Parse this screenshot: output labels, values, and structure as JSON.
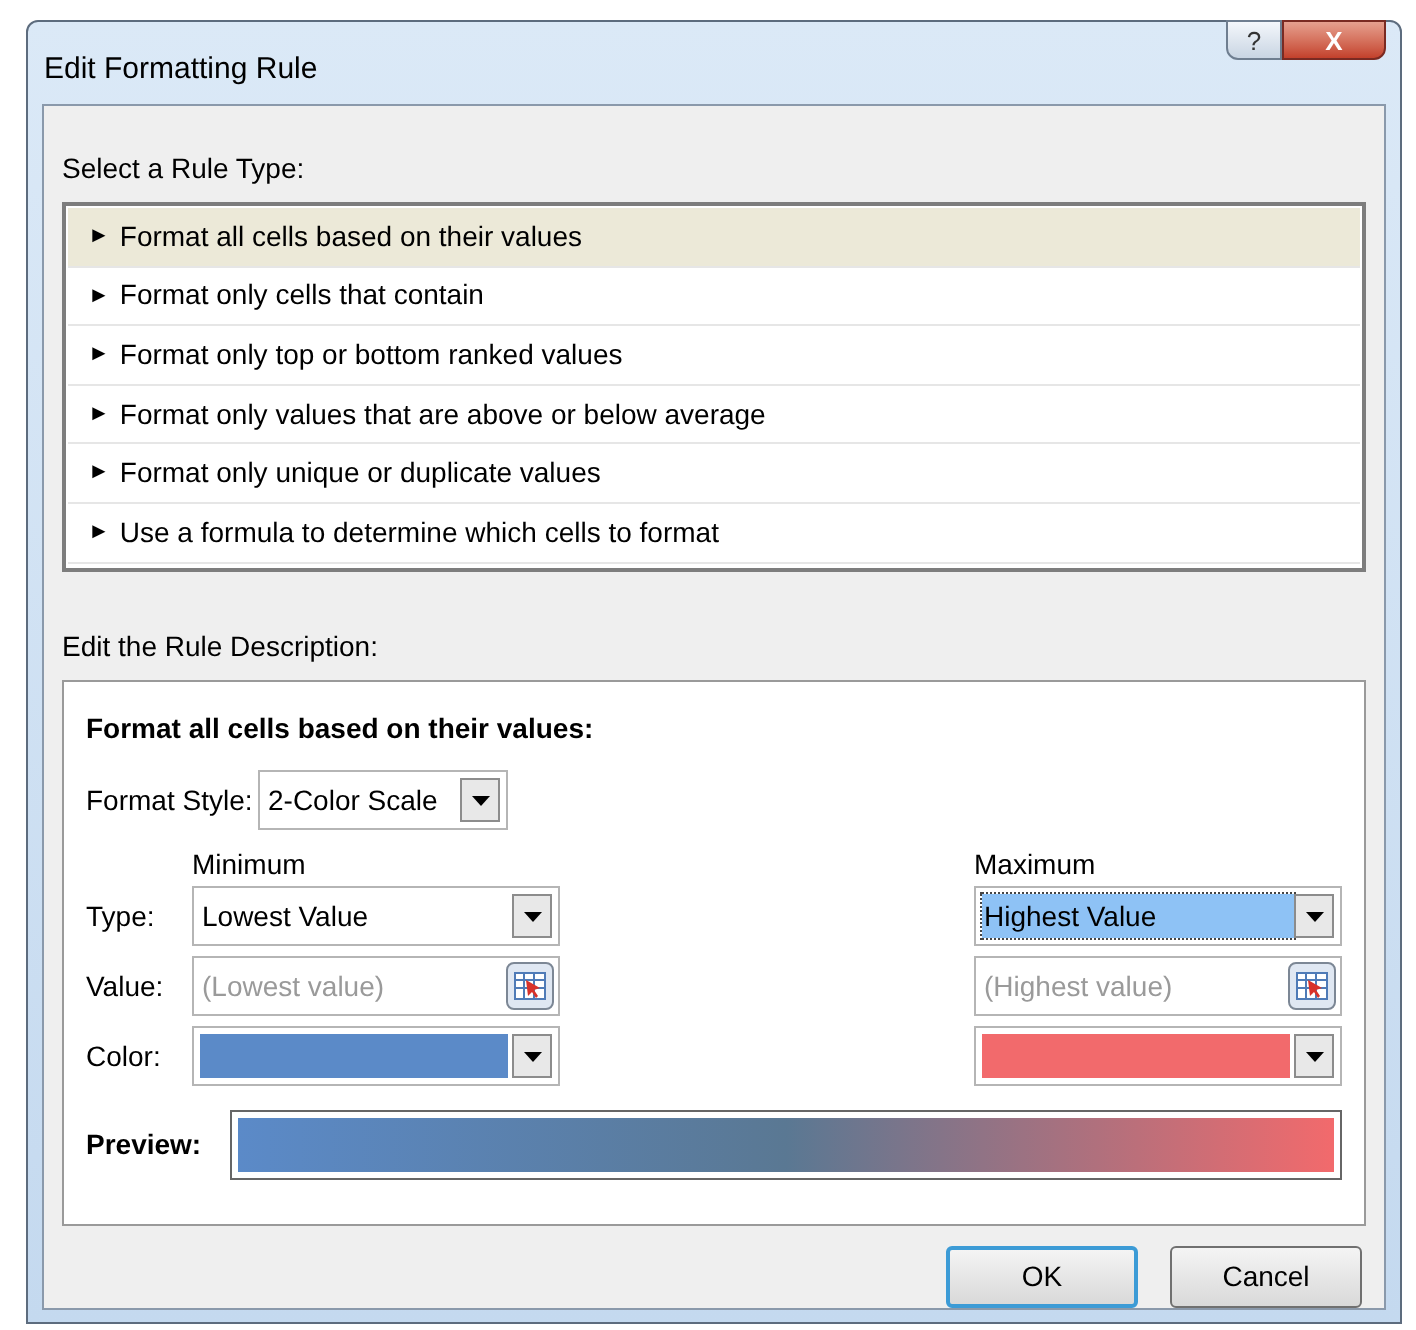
{
  "window": {
    "title": "Edit Formatting Rule",
    "help": "?",
    "close": "X"
  },
  "rule_types": {
    "label": "Select a Rule Type:",
    "items": [
      {
        "arrow": "►",
        "label": "Format all cells based on their values",
        "selected": true
      },
      {
        "arrow": "►",
        "label": "Format only cells that contain",
        "selected": false
      },
      {
        "arrow": "►",
        "label": "Format only top or bottom ranked values",
        "selected": false
      },
      {
        "arrow": "►",
        "label": "Format only values that are above or below average",
        "selected": false
      },
      {
        "arrow": "►",
        "label": "Format only unique or duplicate values",
        "selected": false
      },
      {
        "arrow": "►",
        "label": "Use a formula to determine which cells to format",
        "selected": false
      }
    ]
  },
  "description": {
    "label": "Edit the Rule Description:",
    "heading": "Format all cells based on their values:",
    "format_style": {
      "label": "Format Style:",
      "value": "2-Color Scale"
    },
    "row_labels": [
      "Type:",
      "Value:",
      "Color:"
    ],
    "minimum": {
      "heading": "Minimum",
      "type": "Lowest Value",
      "type_focused": false,
      "value_placeholder": "(Lowest value)",
      "color": "#5b8ac8"
    },
    "maximum": {
      "heading": "Maximum",
      "type": "Highest Value",
      "type_focused": true,
      "value_placeholder": "(Highest value)",
      "color": "#f26a6c"
    },
    "preview_label": "Preview:"
  },
  "buttons": [
    "OK",
    "Cancel"
  ]
}
